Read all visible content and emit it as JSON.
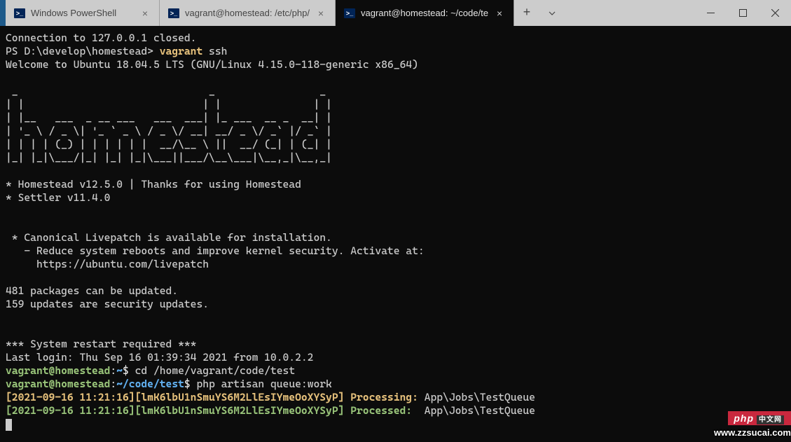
{
  "tabs": [
    {
      "title": "Windows PowerShell",
      "active": false
    },
    {
      "title": "vagrant@homestead: /etc/php/",
      "active": false
    },
    {
      "title": "vagrant@homestead: ~/code/te",
      "active": true
    }
  ],
  "term": {
    "l1": "Connection to 127.0.0.1 closed.",
    "l2a": "PS D:\\develop\\homestead> ",
    "l2b": "vagrant",
    "l2c": " ssh",
    "l3": "Welcome to Ubuntu 18.04.5 LTS (GNU/Linux 4.15.0-118-generic x86_64)",
    "ascii1": " _                               _                 _",
    "ascii2": "| |                             | |               | |",
    "ascii3": "| |__   ___  _ __ ___   ___  ___| |_ ___  __ _  __| |",
    "ascii4": "| '_ \\ / _ \\| '_ ` _ \\ / _ \\/ __| __/ _ \\/ _` |/ _` |",
    "ascii5": "| | | | (_) | | | | | |  __/\\__ \\ ||  __/ (_| | (_| |",
    "ascii6": "|_| |_|\\___/|_| |_| |_|\\___||___/\\__\\___|\\__,_|\\__,_|",
    "hs1": "* Homestead v12.5.0 | Thanks for using Homestead",
    "hs2": "* Settler v11.4.0",
    "lp1": " * Canonical Livepatch is available for installation.",
    "lp2": "   - Reduce system reboots and improve kernel security. Activate at:",
    "lp3": "     https://ubuntu.com/livepatch",
    "pkg1": "481 packages can be updated.",
    "pkg2": "159 updates are security updates.",
    "restart": "*** System restart required ***",
    "lastlogin": "Last login: Thu Sep 16 01:39:34 2021 from 10.0.2.2",
    "p1_user": "vagrant@homestead",
    "p1_colon": ":",
    "p1_path": "~",
    "p1_dollar": "$ ",
    "p1_cmd": "cd /home/vagrant/code/test",
    "p2_user": "vagrant@homestead",
    "p2_colon": ":",
    "p2_path": "~/code/test",
    "p2_dollar": "$ ",
    "p2_cmd": "php artisan queue:work",
    "q1_ts": "[2021-09-16 11:21:16][lmK6lbU1nSmuYS6M2LlEsIYmeOoXYSyP]",
    "q1_status": " Processing:",
    "q1_job": " App\\Jobs\\TestQueue",
    "q2_ts": "[2021-09-16 11:21:16][lmK6lbU1nSmuYS6M2LlEsIYmeOoXYSyP]",
    "q2_status": " Processed: ",
    "q2_job": " App\\Jobs\\TestQueue"
  },
  "watermarks": {
    "php": "php",
    "phpcn": "中文网",
    "zz": "www.zzsucai.com"
  }
}
